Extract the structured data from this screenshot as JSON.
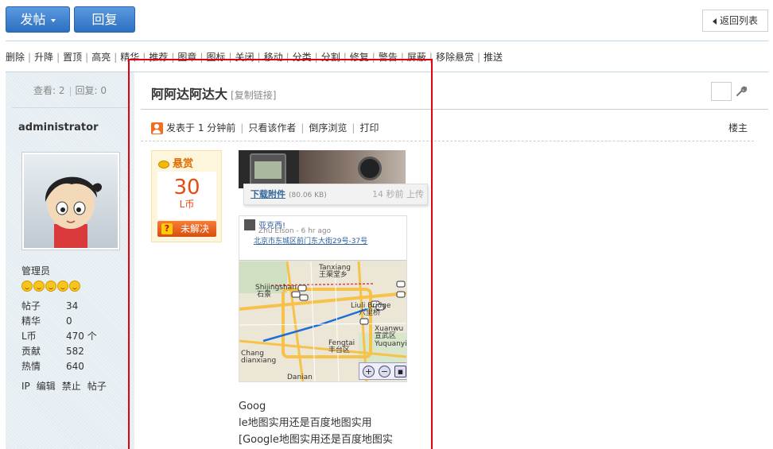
{
  "toolbar": {
    "post_label": "发帖",
    "reply_label": "回复",
    "back_label": "返回列表"
  },
  "modbar": {
    "items": [
      "删除",
      "升降",
      "置顶",
      "高亮",
      "精华",
      "推荐",
      "图章",
      "图标",
      "关闭",
      "移动",
      "分类",
      "分割",
      "修复",
      "警告",
      "屏蔽",
      "移除悬赏",
      "推送"
    ]
  },
  "author": {
    "views_label": "查看:",
    "views": "2",
    "replies_label": "回复:",
    "replies": "0",
    "name": "administrator",
    "group": "管理员",
    "stats": [
      {
        "key": "帖子",
        "value": "34"
      },
      {
        "key": "精华",
        "value": "0"
      },
      {
        "key": "L币",
        "value": "470 个"
      },
      {
        "key": "贡献",
        "value": "582"
      },
      {
        "key": "热情",
        "value": "640"
      }
    ],
    "actions": [
      "IP",
      "编辑",
      "禁止",
      "帖子"
    ],
    "star_count": 5
  },
  "post": {
    "title": "阿阿达阿达大",
    "copy_link": "[复制链接]",
    "meta": {
      "posted": "发表于",
      "time": "1 分钟前",
      "only_author": "只看该作者",
      "reverse": "倒序浏览",
      "print": "打印"
    },
    "floor": "楼主",
    "reward": {
      "label": "悬赏",
      "value": "30",
      "unit": "L币",
      "status": "未解决"
    },
    "attachment": {
      "link": "下载附件",
      "size": "(80.06 KB)",
      "time": "14 秒前 上传"
    },
    "map": {
      "poster": "亚克西!",
      "poster_meta": "Zhu Elson - 6 hr ago",
      "address": "北京市东城区前门东大街29号-37号",
      "labels": [
        "Tanxiang",
        "王渠堂乡",
        "Shijingshan",
        "石景",
        "Liuli Bridge",
        "六里桥",
        "Xuanwu",
        "宣武区",
        "Fengtai",
        "丰台区",
        "Yuquanying",
        "Chang",
        "dianxiang",
        "Danian"
      ]
    },
    "text_lines": [
      "Goog",
      "le地图实用还是百度地图实用",
      "[Google地图实用还是百度地图实"
    ]
  },
  "colors": {
    "accent_blue": "#2d6fc2",
    "highlight_red": "#e0000e",
    "reward_orange": "#e84a10"
  }
}
